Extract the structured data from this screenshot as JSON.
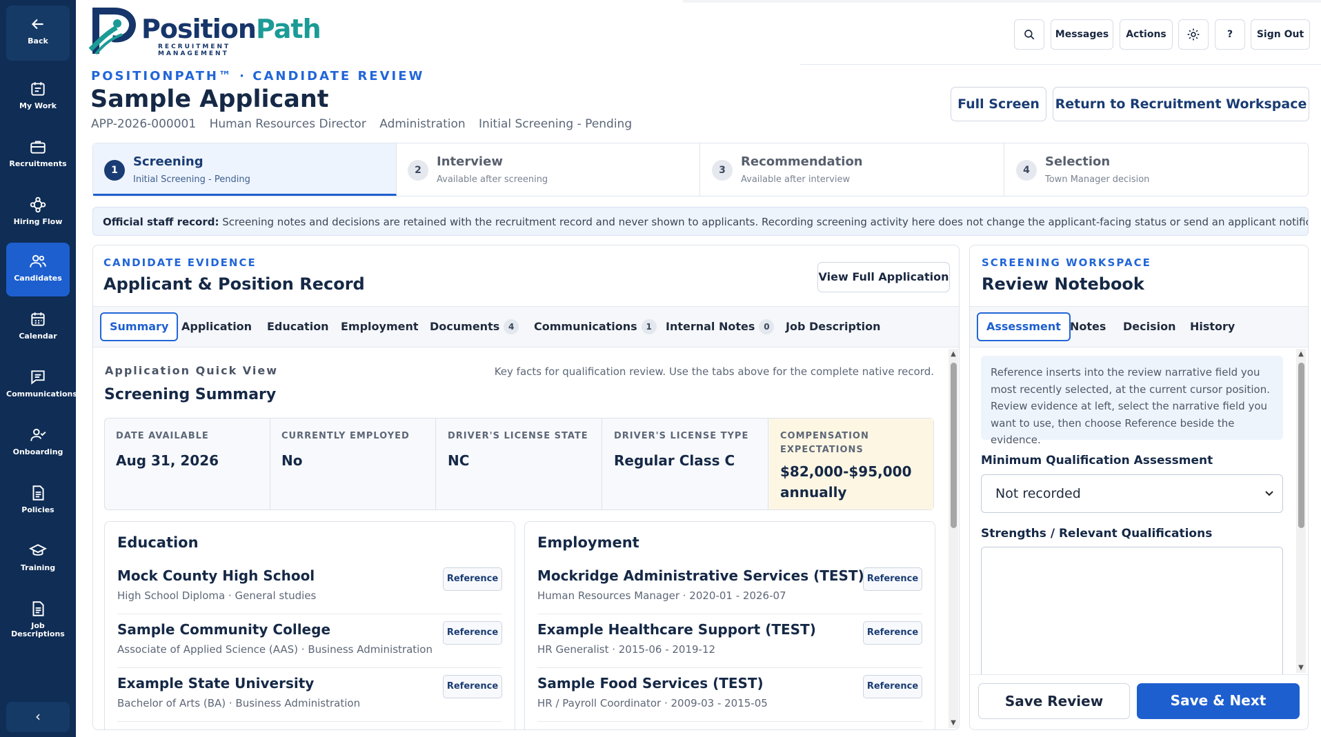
{
  "brand": {
    "name_part1": "Position",
    "name_part2": "Path",
    "tagline": "RECRUITMENT MANAGEMENT"
  },
  "sidebar": {
    "items": [
      {
        "label": "Back",
        "icon": "arrow-left-icon"
      },
      {
        "label": "My Work",
        "icon": "calendar-check-icon"
      },
      {
        "label": "Recruitments",
        "icon": "briefcase-icon"
      },
      {
        "label": "Hiring Flow",
        "icon": "flow-icon"
      },
      {
        "label": "Candidates",
        "icon": "users-icon"
      },
      {
        "label": "Calendar",
        "icon": "calendar-icon"
      },
      {
        "label": "Communications",
        "icon": "chat-icon"
      },
      {
        "label": "Onboarding",
        "icon": "user-check-icon"
      },
      {
        "label": "Policies",
        "icon": "document-icon"
      },
      {
        "label": "Training",
        "icon": "graduation-cap-icon"
      },
      {
        "label": "Job Descriptions",
        "icon": "document-icon"
      }
    ],
    "active": "Candidates",
    "collapse_label": "‹"
  },
  "topbar": {
    "messages": "Messages",
    "actions": "Actions",
    "help": "?",
    "sign_out": "Sign Out"
  },
  "header": {
    "eyebrow": "POSITIONPATH™ · CANDIDATE REVIEW",
    "title": "Sample Applicant",
    "meta": [
      "APP-2026-000001",
      "Human Resources Director",
      "Administration",
      "Initial Screening - Pending"
    ],
    "full_screen": "Full Screen",
    "return": "Return to Recruitment Workspace"
  },
  "steps": [
    {
      "num": "1",
      "title": "Screening",
      "sub": "Initial Screening - Pending",
      "active": true
    },
    {
      "num": "2",
      "title": "Interview",
      "sub": "Available after screening"
    },
    {
      "num": "3",
      "title": "Recommendation",
      "sub": "Available after interview"
    },
    {
      "num": "4",
      "title": "Selection",
      "sub": "Town Manager decision"
    }
  ],
  "notice": {
    "bold": "Official staff record:",
    "text": " Screening notes and decisions are retained with the recruitment record and never shown to applicants. Recording screening activity here does not change the applicant-facing status or send an applicant notification."
  },
  "evidence": {
    "eyebrow": "CANDIDATE EVIDENCE",
    "title": "Applicant & Position Record",
    "view_full": "View Full Application",
    "tabs": [
      {
        "label": "Summary"
      },
      {
        "label": "Application"
      },
      {
        "label": "Education"
      },
      {
        "label": "Employment"
      },
      {
        "label": "Documents",
        "count": "4"
      },
      {
        "label": "Communications",
        "count": "1"
      },
      {
        "label": "Internal Notes",
        "count": "0"
      },
      {
        "label": "Job Description"
      }
    ],
    "quick_eyebrow": "Application Quick View",
    "quick_title": "Screening Summary",
    "quick_hint": "Key facts for qualification review. Use the tabs above for the complete native record.",
    "facts": [
      {
        "label": "DATE AVAILABLE",
        "value": "Aug 31, 2026"
      },
      {
        "label": "CURRENTLY EMPLOYED",
        "value": "No"
      },
      {
        "label": "DRIVER'S LICENSE STATE",
        "value": "NC"
      },
      {
        "label": "DRIVER'S LICENSE TYPE",
        "value": "Regular Class C"
      },
      {
        "label": "COMPENSATION EXPECTATIONS",
        "value": "$82,000-$95,000 annually"
      }
    ],
    "reference_label": "Reference",
    "education": {
      "heading": "Education",
      "items": [
        {
          "title": "Mock County High School",
          "detail": "High School Diploma · General studies"
        },
        {
          "title": "Sample Community College",
          "detail": "Associate of Applied Science (AAS) · Business Administration"
        },
        {
          "title": "Example State University",
          "detail": "Bachelor of Arts (BA) · Business Administration"
        }
      ]
    },
    "employment": {
      "heading": "Employment",
      "items": [
        {
          "title": "Mockridge Administrative Services (TEST)",
          "detail": "Human Resources Manager · 2020-01 - 2026-07"
        },
        {
          "title": "Example Healthcare Support (TEST)",
          "detail": "HR Generalist · 2015-06 - 2019-12"
        },
        {
          "title": "Sample Food Services (TEST)",
          "detail": "HR / Payroll Coordinator · 2009-03 - 2015-05"
        }
      ]
    }
  },
  "workspace": {
    "eyebrow": "SCREENING WORKSPACE",
    "title": "Review Notebook",
    "tabs": [
      "Assessment",
      "Notes",
      "Decision",
      "History"
    ],
    "note": "Reference inserts into the review narrative field you most recently selected, at the current cursor position. Review evidence at left, select the narrative field you want to use, then choose Reference beside the evidence.",
    "min_qual_label": "Minimum Qualification Assessment",
    "min_qual_value": "Not recorded",
    "strengths_label": "Strengths / Relevant Qualifications",
    "save_review": "Save Review",
    "save_next": "Save & Next"
  },
  "colors": {
    "sidebar": "#0f2d55",
    "accent": "#1d5fcf",
    "brand_teal": "#1b9b96"
  }
}
